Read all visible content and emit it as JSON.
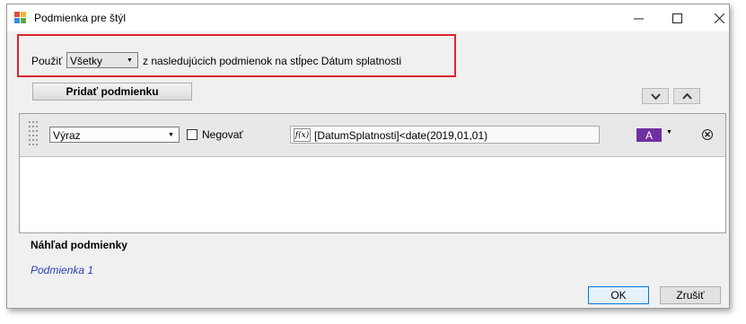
{
  "window": {
    "title": "Podmienka pre štýl"
  },
  "apply": {
    "label": "Použiť",
    "selected": "Všetky",
    "suffix_text": "z nasledujúcich podmienok na stĺpec Dátum splatnosti"
  },
  "toolbar": {
    "add_label": "Pridať podmienku"
  },
  "condition": {
    "type_selected": "Výraz",
    "negate_label": "Negovať",
    "negate_checked": false,
    "fx_icon_text": "f(x)",
    "expression": "[DatumSplatnosti]<date(2019,01,01)",
    "format_preview": "A",
    "format_color": "#7030a0"
  },
  "preview": {
    "heading": "Náhľad podmienky",
    "text": "Podmienka 1"
  },
  "dialog": {
    "ok_label": "OK",
    "cancel_label": "Zrušiť"
  },
  "colors": {
    "highlight_border": "#d9262b",
    "preview_text": "#2a3fb8"
  }
}
